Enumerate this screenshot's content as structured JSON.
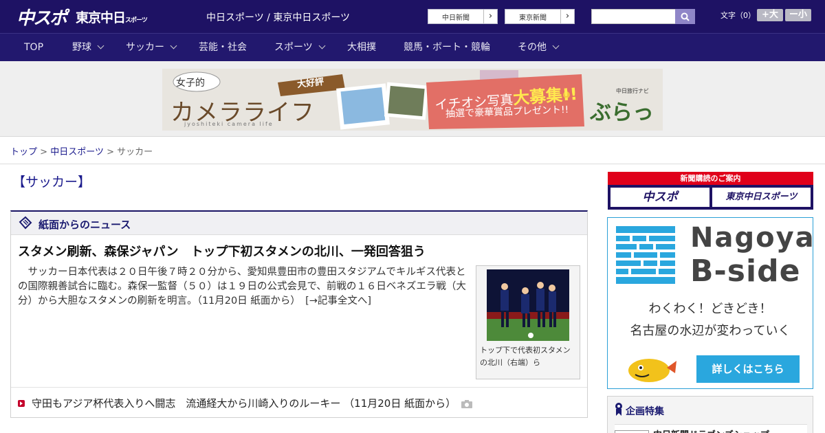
{
  "header": {
    "logo_chuspo": "中スポ",
    "logo_tokyo": "東京中日",
    "logo_tokyo_small": "スポーツ",
    "site_links": "中日スポーツ / 東京中日スポーツ",
    "paper_buttons": [
      "中日新聞",
      "東京新聞"
    ],
    "search": {
      "placeholder": "",
      "value": ""
    },
    "text_size_label": "文字（0）",
    "text_size_plus": "+大",
    "text_size_minus": "ー小"
  },
  "nav": {
    "items": [
      {
        "label": "TOP",
        "has_dropdown": false
      },
      {
        "label": "野球",
        "has_dropdown": true
      },
      {
        "label": "サッカー",
        "has_dropdown": true
      },
      {
        "label": "芸能・社会",
        "has_dropdown": false
      },
      {
        "label": "スポーツ",
        "has_dropdown": true
      },
      {
        "label": "大相撲",
        "has_dropdown": false
      },
      {
        "label": "競馬・ボート・競輪",
        "has_dropdown": false
      },
      {
        "label": "その他",
        "has_dropdown": true
      }
    ]
  },
  "banner": {
    "badge": "女子的",
    "popular": "大好評",
    "title": "カメラライフ",
    "subtitle": "jyoshiteki camera life",
    "headline_pre": "イチオシ写真",
    "headline_big": "大募集!!",
    "prize": "抽選で豪華賞品プレゼント!!",
    "brand_small": "中日旅行ナビ",
    "brand": "ぶらっ人"
  },
  "breadcrumb": {
    "top": "トップ",
    "sep": ">",
    "paper": "中日スポーツ",
    "current": "サッカー"
  },
  "section": {
    "title": "【サッカー】",
    "box_label": "紙面からのニュース"
  },
  "article": {
    "title": "スタメン刷新、森保ジャパン　トップ下初スタメンの北川、一発回答狙う",
    "body": "　サッカー日本代表は２０日午後７時２０分から、愛知県豊田市の豊田スタジアムでキルギス代表との国際親善試合に臨む。森保一監督（５０）は１９日の公式会見で、前戦の１６日ベネズエラ戦（大分）から大胆なスタメンの刷新を明言。（11月20日 紙面から）　[→記事全文へ]",
    "photo_caption": "トップ下で代表初スタメンの北川（右端）ら"
  },
  "related": {
    "text": "守田もアジア杯代表入りへ闘志　流通経大から川崎入りのルーキー （11月20日 紙面から）"
  },
  "sidebar": {
    "subscribe_head": "新聞購読のご案内",
    "subscribe_logos": [
      "中スポ",
      "東京中日スポーツ"
    ],
    "ad": {
      "name_line1": "Nagoya",
      "name_line2": "B-side",
      "line1": "わくわく！どきどき！",
      "line2": "名古屋の水辺が変わっていく",
      "button": "詳しくはこちら"
    },
    "feature_label": "企画特集",
    "feature_item": "中日新聞ドラゴンズショップ"
  },
  "colors": {
    "header_bg": "#1e1264",
    "nav_bg": "#22186e",
    "link": "#1a1a8c",
    "accent_red": "#e0001a",
    "ad_blue": "#2aa7de"
  }
}
